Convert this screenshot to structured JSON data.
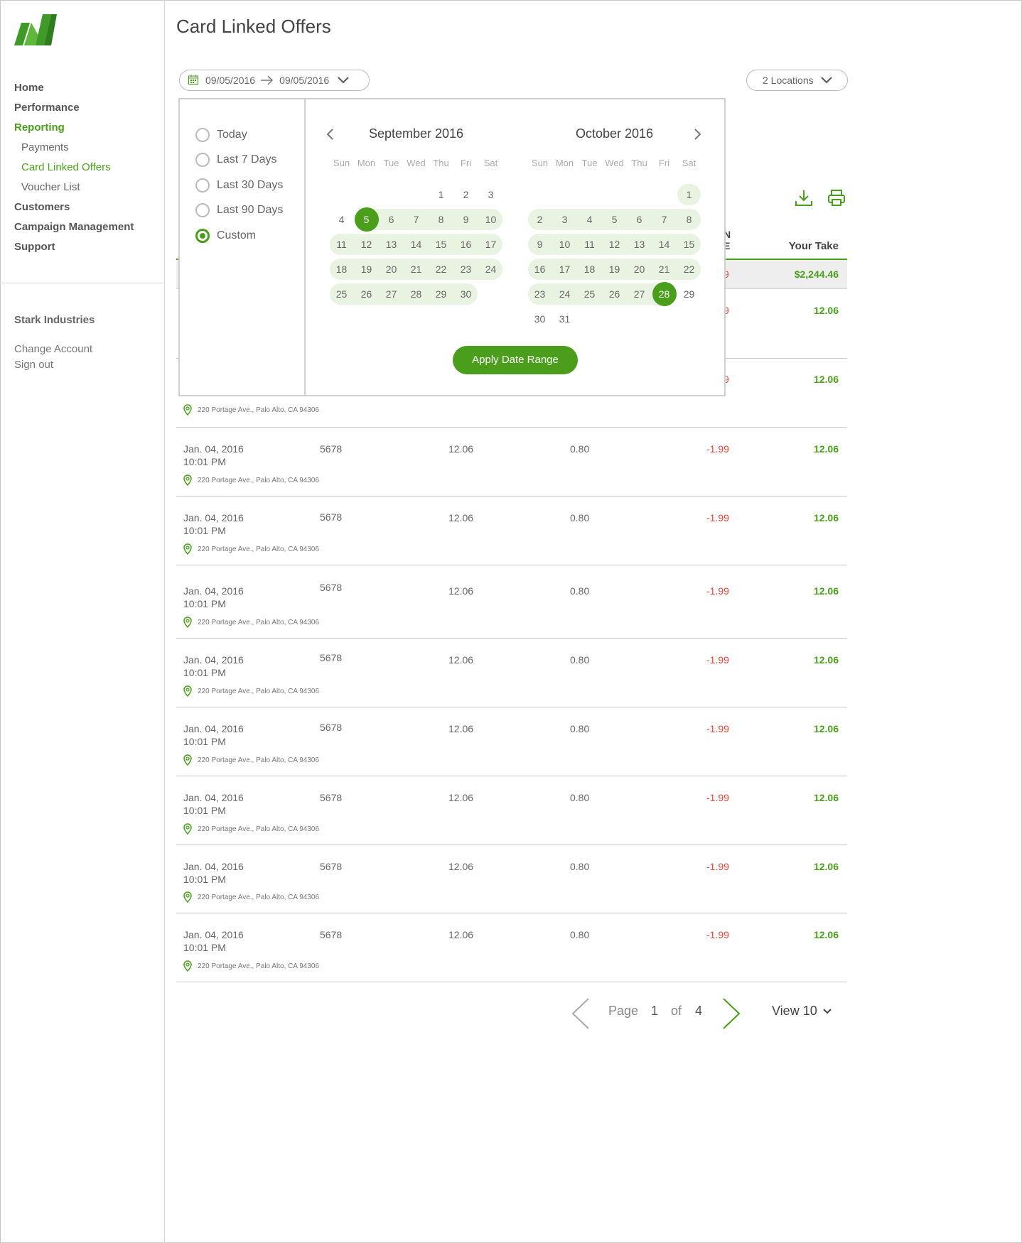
{
  "app": {
    "title": "Card Linked Offers"
  },
  "sidebar": {
    "items": [
      {
        "label": "Home",
        "type": "top"
      },
      {
        "label": "Performance",
        "type": "top"
      },
      {
        "label": "Reporting",
        "type": "top-active"
      },
      {
        "label": "Payments",
        "type": "sub"
      },
      {
        "label": "Card Linked Offers",
        "type": "sub-active"
      },
      {
        "label": "Voucher List",
        "type": "sub"
      },
      {
        "label": "Customers",
        "type": "top"
      },
      {
        "label": "Campaign Management",
        "type": "top"
      },
      {
        "label": "Support",
        "type": "top"
      }
    ],
    "account": {
      "company": "Stark Industries",
      "change": "Change Account",
      "signout": "Sign out"
    }
  },
  "filters": {
    "date_from": "09/05/2016",
    "date_to": "09/05/2016",
    "locations": "2 Locations"
  },
  "table": {
    "header_partial": "N\nE",
    "header_your_take": "Your Take",
    "total": {
      "partial_negative": "9",
      "your_take": "$2,244.46"
    },
    "partial_rows": [
      {
        "neg": "9",
        "take": "12.06"
      },
      {
        "neg": "9",
        "take": "12.06",
        "address": "220 Portage Ave., Palo Alto, CA 94306"
      }
    ],
    "rows": [
      {
        "date": "Jan. 04, 2016",
        "time": "10:01 PM",
        "card": "5678",
        "amount": "12.06",
        "fee": "0.80",
        "neg": "-1.99",
        "take": "12.06",
        "address": "220 Portage Ave., Palo Alto, CA 94306"
      },
      {
        "date": "Jan. 04, 2016",
        "time": "10:01 PM",
        "card": "5678",
        "amount": "12.06",
        "fee": "0.80",
        "neg": "-1.99",
        "take": "12.06",
        "address": "220 Portage Ave., Palo Alto, CA 94306"
      },
      {
        "date": "Jan. 04, 2016",
        "time": "10:01 PM",
        "card": "5678",
        "amount": "12.06",
        "fee": "0.80",
        "neg": "-1.99",
        "take": "12.06",
        "address": "220 Portage Ave., Palo Alto, CA 94306"
      },
      {
        "date": "Jan. 04, 2016",
        "time": "10:01 PM",
        "card": "5678",
        "amount": "12.06",
        "fee": "0.80",
        "neg": "-1.99",
        "take": "12.06",
        "address": "220 Portage Ave., Palo Alto, CA 94306"
      },
      {
        "date": "Jan. 04, 2016",
        "time": "10:01 PM",
        "card": "5678",
        "amount": "12.06",
        "fee": "0.80",
        "neg": "-1.99",
        "take": "12.06",
        "address": "220 Portage Ave., Palo Alto, CA 94306"
      },
      {
        "date": "Jan. 04, 2016",
        "time": "10:01 PM",
        "card": "5678",
        "amount": "12.06",
        "fee": "0.80",
        "neg": "-1.99",
        "take": "12.06",
        "address": "220 Portage Ave., Palo Alto, CA 94306"
      },
      {
        "date": "Jan. 04, 2016",
        "time": "10:01 PM",
        "card": "5678",
        "amount": "12.06",
        "fee": "0.80",
        "neg": "-1.99",
        "take": "12.06",
        "address": "220 Portage Ave., Palo Alto, CA 94306"
      },
      {
        "date": "Jan. 04, 2016",
        "time": "10:01 PM",
        "card": "5678",
        "amount": "12.06",
        "fee": "0.80",
        "neg": "-1.99",
        "take": "12.06",
        "address": "220 Portage Ave., Palo Alto, CA 94306"
      }
    ]
  },
  "pagination": {
    "page_label": "Page",
    "current": "1",
    "of_label": "of",
    "total": "4",
    "view_label": "View 10"
  },
  "datepicker": {
    "presets": [
      {
        "label": "Today",
        "selected": false
      },
      {
        "label": "Last 7 Days",
        "selected": false
      },
      {
        "label": "Last 30 Days",
        "selected": false
      },
      {
        "label": "Last 90 Days",
        "selected": false
      },
      {
        "label": "Custom",
        "selected": true
      }
    ],
    "weekdays": [
      "Sun",
      "Mon",
      "Tue",
      "Wed",
      "Thu",
      "Fri",
      "Sat"
    ],
    "months": [
      {
        "title": "September 2016",
        "first_weekday": 4,
        "days": 30,
        "range_start": 5,
        "range_end": 30,
        "selected": [
          5
        ]
      },
      {
        "title": "October 2016",
        "first_weekday": 6,
        "days": 31,
        "range_start": 1,
        "range_end": 28,
        "selected": [
          28
        ]
      }
    ],
    "apply_label": "Apply Date Range"
  },
  "colors": {
    "accent": "#4a9e1c",
    "negative": "#e0453a",
    "range_bg": "#e8f3e1"
  },
  "icons": [
    "logo-icon",
    "calendar-icon",
    "arrow-right-icon",
    "chevron-down-icon",
    "download-icon",
    "print-icon",
    "location-pin-icon",
    "chevron-left-icon",
    "chevron-right-icon"
  ]
}
